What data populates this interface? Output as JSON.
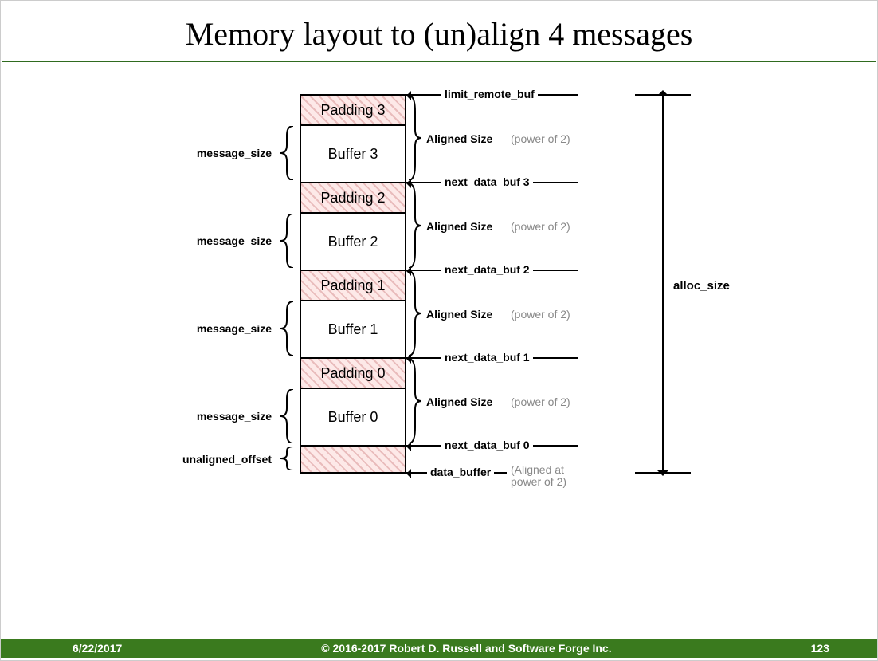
{
  "title": "Memory layout to (un)align 4 messages",
  "footer": {
    "date": "6/22/2017",
    "copyright": "© 2016-2017 Robert D. Russell and Software Forge Inc.",
    "page": "123"
  },
  "alloc_label": "alloc_size",
  "top_ptr": "limit_remote_buf",
  "bottom_ptr": "data_buffer",
  "bottom_note_l1": "(Aligned at",
  "bottom_note_l2": "power of 2)",
  "unaligned_label": "unaligned_offset",
  "blocks": [
    {
      "pad": "Padding 3",
      "buf": "Buffer 3",
      "msg": "message_size",
      "aligned": "Aligned Size",
      "pow": "(power of 2)",
      "ptr": "next_data_buf 3"
    },
    {
      "pad": "Padding 2",
      "buf": "Buffer 2",
      "msg": "message_size",
      "aligned": "Aligned Size",
      "pow": "(power of 2)",
      "ptr": "next_data_buf 2"
    },
    {
      "pad": "Padding 1",
      "buf": "Buffer 1",
      "msg": "message_size",
      "aligned": "Aligned Size",
      "pow": "(power of 2)",
      "ptr": "next_data_buf 1"
    },
    {
      "pad": "Padding 0",
      "buf": "Buffer 0",
      "msg": "message_size",
      "aligned": "Aligned Size",
      "pow": "(power of 2)",
      "ptr": "next_data_buf 0"
    }
  ]
}
